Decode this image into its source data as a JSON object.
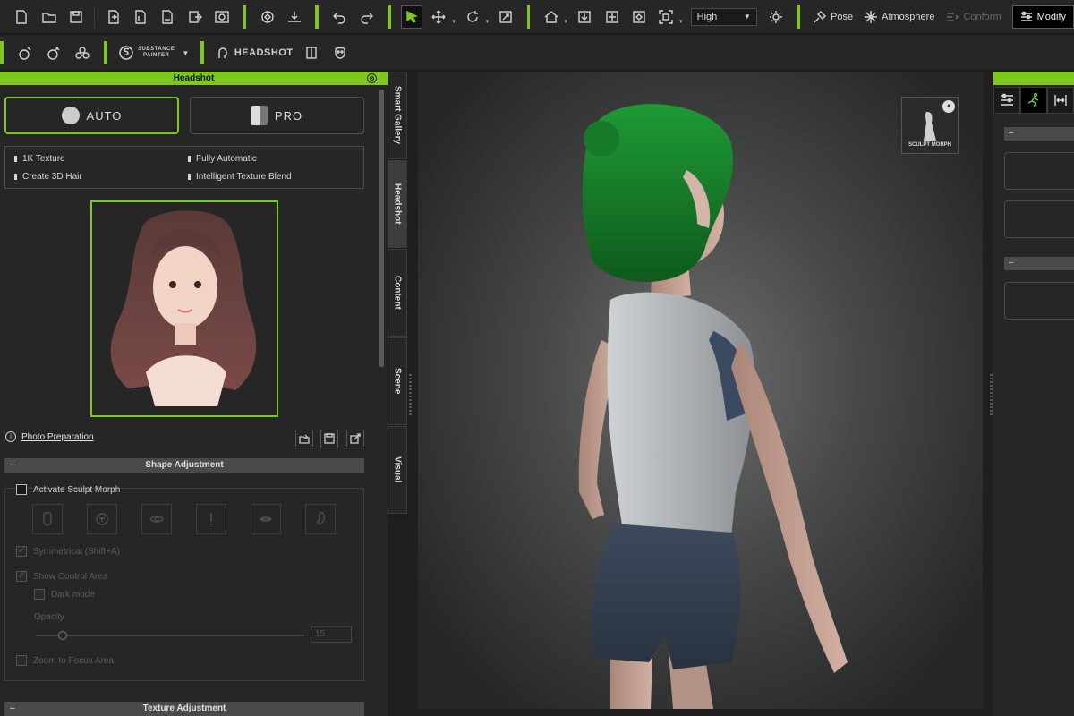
{
  "toolbar_top": {
    "quality_dropdown": "High",
    "pose_label": "Pose",
    "atmosphere_label": "Atmosphere",
    "conform_label": "Conform",
    "modify_label": "Modify"
  },
  "toolbar_second": {
    "substance_line1": "SUBSTANCE",
    "substance_line2": "PAINTER",
    "headshot_label": "HEADSHOT"
  },
  "headshot_panel": {
    "title": "Headshot",
    "close_glyph": "⊗",
    "auto_label": "AUTO",
    "pro_label": "PRO",
    "features": [
      "1K Texture",
      "Fully Automatic",
      "Create 3D Hair",
      "Intelligent Texture Blend"
    ],
    "photo_prep_link": "Photo Preparation",
    "shape_adjustment_header": "Shape Adjustment",
    "activate_sculpt_morph": "Activate Sculpt Morph",
    "symmetrical": "Symmetrical (Shift+A)",
    "show_control_area": "Show Control Area",
    "dark_mode": "Dark mode",
    "opacity_label": "Opacity",
    "opacity_value": "15",
    "zoom_to_focus": "Zoom to Focus Area",
    "texture_adjustment_header": "Texture Adjustment",
    "collapse_glyph": "–"
  },
  "side_tabs": [
    "Smart Gallery",
    "Headshot",
    "Content",
    "Scene",
    "Visual"
  ],
  "viewport": {
    "sculpt_morph_label": "SCULPT MORPH"
  },
  "right_panel": {
    "collapse_glyph": "–"
  },
  "colors": {
    "accent_green": "#7ec81e",
    "panel_bg": "#262626",
    "hair_green": "#1f8a2a"
  }
}
